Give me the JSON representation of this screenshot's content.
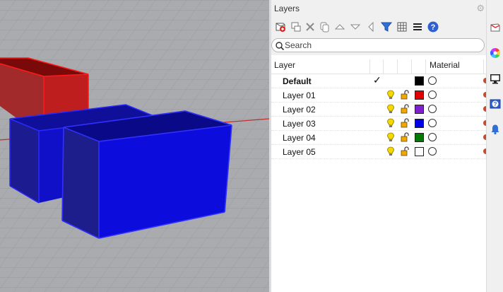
{
  "panel": {
    "title": "Layers"
  },
  "search": {
    "placeholder": "Search"
  },
  "columns": {
    "layer": "Layer",
    "material": "Material"
  },
  "toolbar_icons": [
    "new-layer-icon",
    "new-sublayer-icon",
    "delete-icon",
    "copy-icon",
    "move-up-icon",
    "move-down-icon",
    "move-to-parent-icon",
    "filter-icon",
    "grid-icon",
    "menu-icon",
    "help-icon"
  ],
  "layers": [
    {
      "name": "Default",
      "current": true,
      "color": "#000000",
      "bold": true,
      "show_state": false
    },
    {
      "name": "Layer 01",
      "current": false,
      "color": "#e00000",
      "bold": false,
      "show_state": true
    },
    {
      "name": "Layer 02",
      "current": false,
      "color": "#7f1fcf",
      "bold": false,
      "show_state": true
    },
    {
      "name": "Layer 03",
      "current": false,
      "color": "#0000e8",
      "bold": false,
      "show_state": true
    },
    {
      "name": "Layer 04",
      "current": false,
      "color": "#007a00",
      "bold": false,
      "show_state": true
    },
    {
      "name": "Layer 05",
      "current": false,
      "color": "#ffffff",
      "bold": false,
      "show_state": true
    }
  ],
  "current_mark": "✓",
  "side_icons": [
    "layers-panel-icon",
    "color-wheel-icon",
    "display-icon",
    "help-panel-icon",
    "notification-bell-icon"
  ],
  "colors": {
    "bulb": "#f5d800",
    "lock": "#f0a800",
    "accent": "#2f6fd6"
  }
}
